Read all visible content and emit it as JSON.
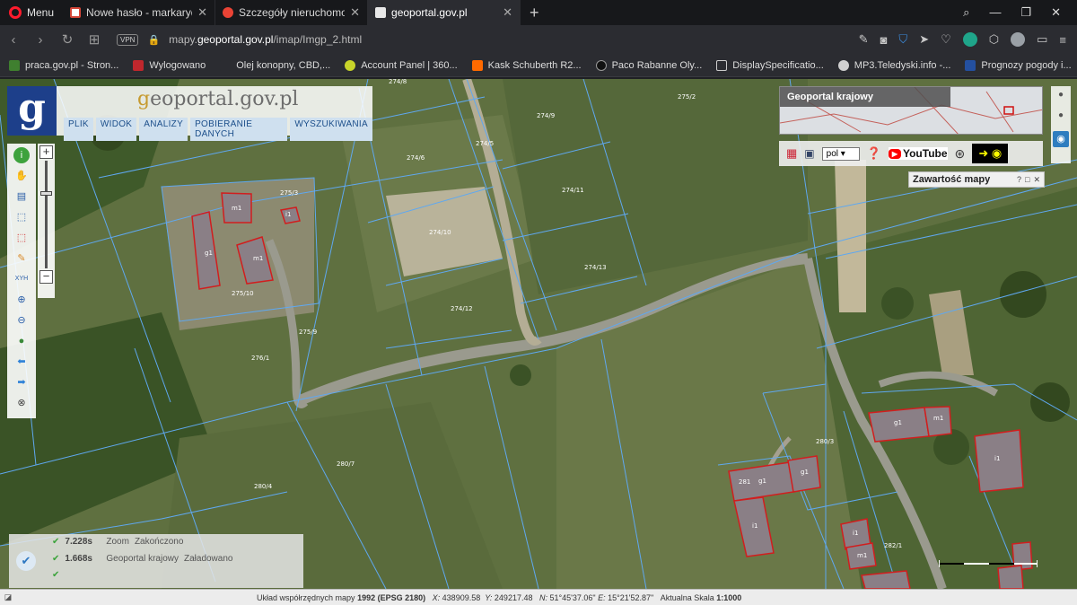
{
  "browser": {
    "menu_label": "Menu",
    "tabs": [
      {
        "title": "Nowe hasło - markaryq@g",
        "fav_color": "#ffffff",
        "active": false
      },
      {
        "title": "Szczegóły nieruchomości -",
        "fav_color": "#ea4335",
        "active": false
      },
      {
        "title": "geoportal.gov.pl",
        "fav_color": "#e8e8e8",
        "active": true
      }
    ],
    "new_tab_symbol": "+",
    "url_prefix": "mapy.",
    "url_domain": "geoportal.gov.pl",
    "url_path": "/imap/Imgp_2.html",
    "vpn_label": "VPN",
    "bookmarks": [
      {
        "label": "praca.gov.pl - Stron...",
        "icon_color": "#3f7f2f"
      },
      {
        "label": "Wylogowano",
        "icon_color": "#c0272d"
      },
      {
        "label": "Olej konopny, CBD,...",
        "icon_color": "#2b2c31"
      },
      {
        "label": "Account Panel | 360...",
        "icon_color": "#c8d42a"
      },
      {
        "label": "Kask Schuberth R2...",
        "icon_color": "#ff6a00"
      },
      {
        "label": "Paco Rabanne Oly...",
        "icon_color": "#111111"
      },
      {
        "label": "DisplaySpecificatio...",
        "icon_color": "#cccccc"
      },
      {
        "label": "MP3.Teledyski.info -...",
        "icon_color": "#d0d0d0"
      },
      {
        "label": "Prognozy pogody i...",
        "icon_color": "#2450a0"
      }
    ],
    "bookmarks_more": "»"
  },
  "geoportal": {
    "logo_letter": "g",
    "logo_text_g": "g",
    "logo_text_rest": "eoportal.gov.pl",
    "menu": [
      "PLIK",
      "WIDOK",
      "ANALIZY",
      "POBIERANIE DANYCH",
      "WYSZUKIWANIA"
    ],
    "overview_title": "Geoportal krajowy",
    "language": "pol",
    "youtube_label": "YouTube",
    "map_content_title": "Zawartość mapy",
    "map_content_ctrls": [
      "?",
      "□",
      "✕"
    ]
  },
  "status_panel": {
    "rows": [
      {
        "time": "7.228s",
        "label": "Zoom",
        "state": "Zakończono"
      },
      {
        "time": "1.668s",
        "label": "Geoportal krajowy",
        "state": "Załadowano"
      }
    ]
  },
  "bottom_bar": {
    "crs_label": "Układ współrzędnych mapy",
    "crs_value": "1992 (EPSG 2180)",
    "x_label": "X:",
    "x_value": "438909.58",
    "y_label": "Y:",
    "y_value": "249217.48",
    "n_label": "N:",
    "n_value": "51°45'37.06\"",
    "e_label": "E:",
    "e_value": "15°21'52.87\"",
    "scale_label": "Aktualna Skala",
    "scale_value": "1:1000"
  },
  "map": {
    "plot_numbers": [
      "274/8",
      "274/9",
      "274/6",
      "274/5",
      "274/11",
      "274/10",
      "274/12",
      "274/13",
      "275/2",
      "275/3",
      "275/10",
      "275/9",
      "276/1",
      "280/7",
      "280/4",
      "280/3",
      "281",
      "282/1"
    ],
    "building_labels": [
      "m1",
      "i1",
      "g1",
      "m1",
      "g1",
      "m1",
      "i1",
      "g1",
      "g1",
      "i1",
      "i1",
      "m1"
    ]
  }
}
